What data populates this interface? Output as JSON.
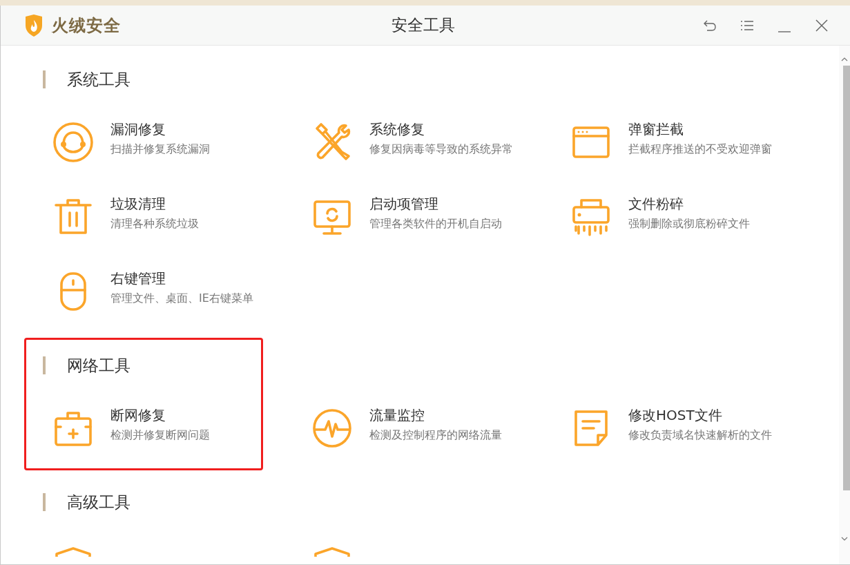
{
  "window": {
    "brand": "火绒安全",
    "title": "安全工具"
  },
  "sections": [
    {
      "title": "系统工具",
      "highlighted": false,
      "items": [
        {
          "title": "漏洞修复",
          "description": "扫描并修复系统漏洞"
        },
        {
          "title": "系统修复",
          "description": "修复因病毒等导致的系统异常"
        },
        {
          "title": "弹窗拦截",
          "description": "拦截程序推送的不受欢迎弹窗"
        },
        {
          "title": "垃圾清理",
          "description": "清理各种系统垃圾"
        },
        {
          "title": "启动项管理",
          "description": "管理各类软件的开机自启动"
        },
        {
          "title": "文件粉碎",
          "description": "强制删除或彻底粉碎文件"
        },
        {
          "title": "右键管理",
          "description": "管理文件、桌面、IE右键菜单"
        }
      ]
    },
    {
      "title": "网络工具",
      "highlighted": true,
      "items": [
        {
          "title": "断网修复",
          "description": "检测并修复断网问题"
        },
        {
          "title": "流量监控",
          "description": "检测及控制程序的网络流量"
        },
        {
          "title": "修改HOST文件",
          "description": "修改负责域名快速解析的文件"
        }
      ]
    },
    {
      "title": "高级工具",
      "highlighted": false,
      "items": [
        {
          "kind": "cut"
        },
        {
          "kind": "cut"
        }
      ]
    }
  ]
}
